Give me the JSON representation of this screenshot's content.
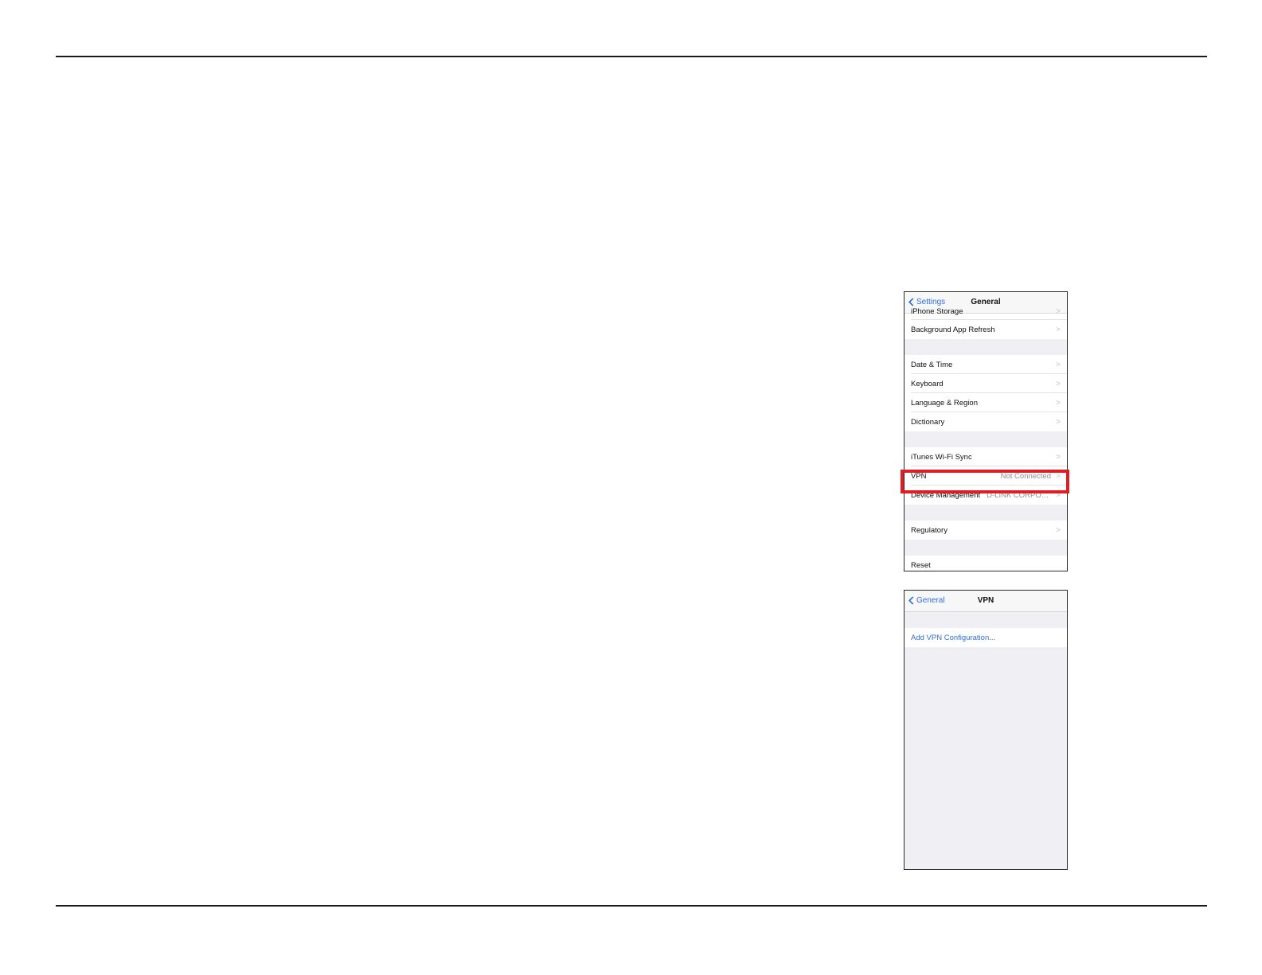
{
  "screen1": {
    "back_label": "Settings",
    "title": "General",
    "rows": [
      {
        "label": "iPhone Storage",
        "value": ""
      },
      {
        "label": "Background App Refresh",
        "value": ""
      },
      {
        "label": "Date & Time",
        "value": ""
      },
      {
        "label": "Keyboard",
        "value": ""
      },
      {
        "label": "Language & Region",
        "value": ""
      },
      {
        "label": "Dictionary",
        "value": ""
      },
      {
        "label": "iTunes Wi-Fi Sync",
        "value": ""
      },
      {
        "label": "VPN",
        "value": "Not Connected"
      },
      {
        "label": "Device Management",
        "value": "D-LINK CORPORA..."
      },
      {
        "label": "Regulatory",
        "value": ""
      },
      {
        "label": "Reset",
        "value": ""
      }
    ]
  },
  "screen2": {
    "back_label": "General",
    "title": "VPN",
    "add_config_label": "Add VPN Configuration..."
  },
  "colors": {
    "accent": "#2f6fde",
    "highlight": "#e21c23",
    "grouped_background": "#efeff4"
  }
}
